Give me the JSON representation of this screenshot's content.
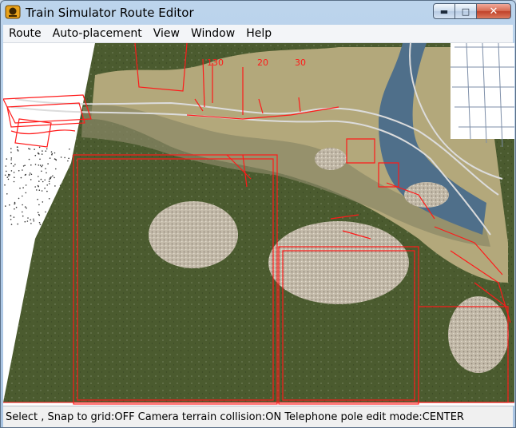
{
  "window": {
    "title": "Train Simulator Route Editor",
    "minimize_label": "▬",
    "maximize_label": "□",
    "close_label": "✕"
  },
  "menu": [
    {
      "label": "Route"
    },
    {
      "label": "Auto-placement"
    },
    {
      "label": "View"
    },
    {
      "label": "Window"
    },
    {
      "label": "Help"
    }
  ],
  "viewport": {
    "markers": [
      "130",
      "30",
      "20"
    ],
    "colors": {
      "terrain_dark": "#4a5a2e",
      "terrain_light": "#b8ab7c",
      "gravel": "#bcb2a3",
      "water": "#4d6d88",
      "outline": "#ff1a1a",
      "grid": "#7d8ea8"
    }
  },
  "status": {
    "text": "Select , Snap to grid:OFF Camera terrain collision:ON Telephone pole edit mode:CENTER"
  }
}
